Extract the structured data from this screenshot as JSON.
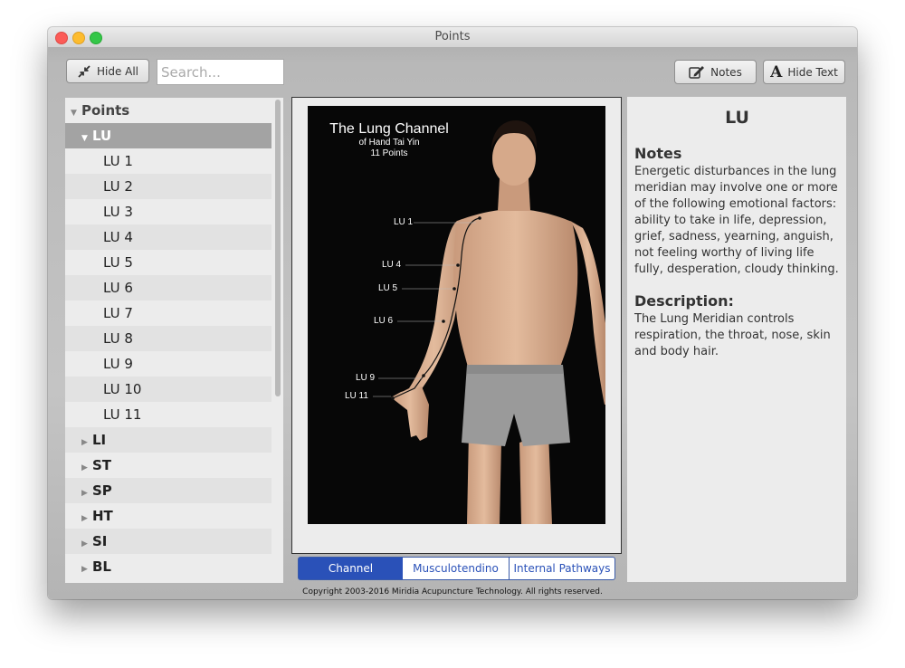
{
  "window": {
    "title": "Points"
  },
  "toolbar": {
    "hide_all_label": "Hide All",
    "search_placeholder": "Search...",
    "notes_label": "Notes",
    "hide_text_label": "Hide Text"
  },
  "tree": {
    "root_label": "Points",
    "selected_channel": "LU",
    "points": [
      "LU 1",
      "LU 2",
      "LU 3",
      "LU 4",
      "LU 5",
      "LU 6",
      "LU 7",
      "LU 8",
      "LU 9",
      "LU 10",
      "LU 11"
    ],
    "other_channels": [
      "LI",
      "ST",
      "SP",
      "HT",
      "SI",
      "BL"
    ]
  },
  "image": {
    "title": "The Lung Channel",
    "subtitle": "of Hand Tai Yin",
    "points_count": "11 Points",
    "point_labels": [
      "LU 1",
      "LU 4",
      "LU 5",
      "LU 6",
      "LU 9",
      "LU 11"
    ]
  },
  "tabs": [
    "Channel",
    "Musculotendino",
    "Internal Pathways"
  ],
  "active_tab": "Channel",
  "info": {
    "heading": "LU",
    "notes_title": "Notes",
    "notes_text": "Energetic disturbances in the lung meridian may involve one or more of the following emotional factors: ability to take in life, depression, grief, sadness, yearning, anguish, not feeling worthy of living life fully, desperation, cloudy thinking.",
    "description_title": "Description:",
    "description_text": "The Lung Meridian controls respiration, the throat, nose, skin and body hair."
  },
  "copyright": "Copyright 2003-2016 Miridia Acupuncture Technology.  All rights reserved.",
  "colors": {
    "accent_blue": "#2a51b8",
    "selected_row": "#a3a3a3",
    "panel_bg": "#ececec"
  }
}
